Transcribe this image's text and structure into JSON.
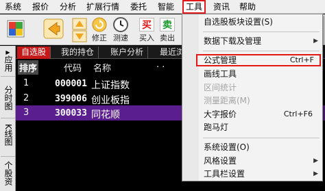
{
  "menubar": {
    "items": [
      {
        "label": "系统"
      },
      {
        "label": "报价"
      },
      {
        "label": "分析"
      },
      {
        "label": "扩展行情"
      },
      {
        "label": "委托"
      },
      {
        "label": "智能"
      },
      {
        "label": "工具"
      },
      {
        "label": "资讯"
      },
      {
        "label": "帮助"
      }
    ],
    "active_index": 6
  },
  "toolbar": {
    "buttons": [
      {
        "label": "",
        "icon": "multi-color-grid-icon"
      },
      {
        "label": "",
        "icon": "back-arrow-icon"
      },
      {
        "label": "",
        "icon": "up-down-arrows-icon"
      },
      {
        "label": "修正",
        "icon": "refresh-circle-icon"
      },
      {
        "label": "测速",
        "icon": "clock-icon"
      },
      {
        "label": "买入",
        "icon_text": "买"
      },
      {
        "label": "卖出",
        "icon_text": "卖"
      }
    ]
  },
  "side_tabs": [
    {
      "label": "应用"
    },
    {
      "label": "分时图"
    },
    {
      "label": "K线图"
    },
    {
      "label": "个股资"
    }
  ],
  "tabs": [
    {
      "label": "自选股"
    },
    {
      "label": "我的持仓"
    },
    {
      "label": "账户分析"
    },
    {
      "label": "最近浏"
    }
  ],
  "table": {
    "headers": [
      "排序",
      "代码",
      "名称",
      ". ."
    ],
    "rows": [
      {
        "rank": "1",
        "code": "000001",
        "name": "上证指数"
      },
      {
        "rank": "2",
        "code": "399006",
        "name": "创业板指"
      },
      {
        "rank": "3",
        "code": "300033",
        "name": "同花顺"
      }
    ],
    "selected_index": 2
  },
  "dropdown": {
    "items": [
      {
        "label": "自选股板块设置(S)"
      },
      {
        "label": "数据下载及管理"
      },
      {
        "label": "公式管理",
        "shortcut": "Ctrl+F"
      },
      {
        "label": "画线工具"
      },
      {
        "label": "区间统计"
      },
      {
        "label": "测量距离(M)"
      },
      {
        "label": "大字报价",
        "shortcut": "Ctrl+F6"
      },
      {
        "label": "跑马灯"
      },
      {
        "label": "系统设置(O)"
      },
      {
        "label": "风格设置"
      },
      {
        "label": "工具栏设置"
      }
    ]
  },
  "colors": {
    "highlight_border": "#e21818",
    "active_tab": "#c61a1a",
    "selected_row": "#5b1e8f"
  }
}
